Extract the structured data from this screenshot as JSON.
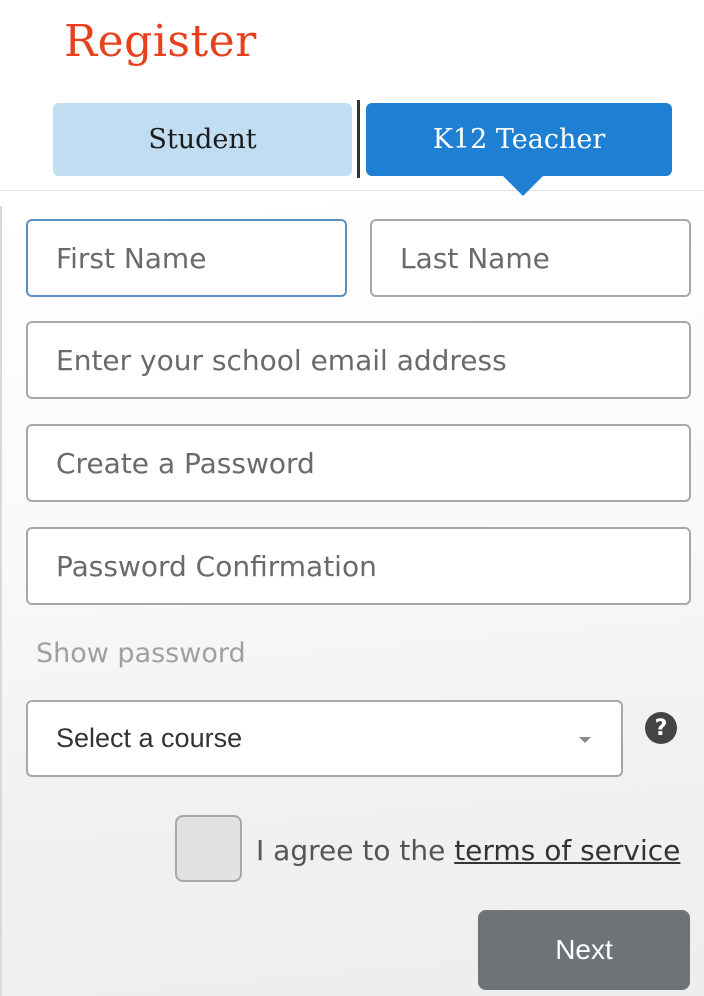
{
  "header": {
    "title": "Register"
  },
  "tabs": [
    {
      "label": "Student",
      "active": false
    },
    {
      "label": "K12 Teacher",
      "active": true
    }
  ],
  "form": {
    "first_name": {
      "placeholder": "First Name",
      "value": ""
    },
    "last_name": {
      "placeholder": "Last Name",
      "value": ""
    },
    "email": {
      "placeholder": "Enter your school email address",
      "value": ""
    },
    "password": {
      "placeholder": "Create a Password",
      "value": ""
    },
    "password_confirmation": {
      "placeholder": "Password Confirmation",
      "value": ""
    },
    "show_password_label": "Show password",
    "course_select": {
      "selected": "Select a course"
    },
    "help_icon_glyph": "?",
    "agree_prefix": "I agree to the ",
    "terms_link": "terms of service",
    "agree_checked": false,
    "next_label": "Next"
  },
  "colors": {
    "title": "#e8401c",
    "tab_active": "#1f80d3",
    "tab_inactive": "#c0ddf2",
    "next_button": "#6d7377"
  }
}
